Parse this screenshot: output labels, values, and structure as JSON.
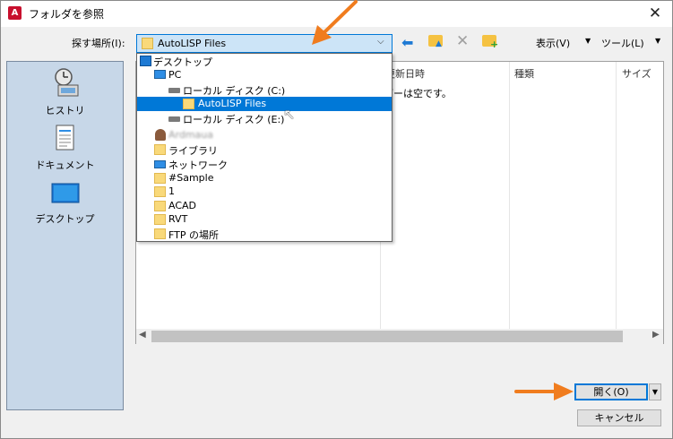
{
  "window": {
    "title": "フォルダを参照",
    "app_icon_letter": "A",
    "close_glyph": "✕"
  },
  "toolbar": {
    "lookin_label": "探す場所(I):",
    "lookin_value": "AutoLISP Files",
    "view_label": "表示(V)",
    "tools_label": "ツール(L)"
  },
  "places": [
    {
      "label": "ヒストリ",
      "icon": "history-icon"
    },
    {
      "label": "ドキュメント",
      "icon": "documents-icon"
    },
    {
      "label": "デスクトップ",
      "icon": "desktop-icon"
    }
  ],
  "filelist": {
    "columns": [
      "更新日時",
      "種類",
      "サイズ"
    ],
    "empty_message": "ダーは空です。"
  },
  "dropdown": {
    "items": [
      {
        "label": "デスクトップ",
        "icon": "desktop-icon",
        "indent": 0,
        "selected": false
      },
      {
        "label": "PC",
        "icon": "pc-icon",
        "indent": 1,
        "selected": false
      },
      {
        "label": "ローカル ディスク (C:)",
        "icon": "drive-icon",
        "indent": 2,
        "selected": false
      },
      {
        "label": "AutoLISP Files",
        "icon": "folder-icon",
        "indent": 3,
        "selected": true
      },
      {
        "label": "ローカル ディスク (E:)",
        "icon": "drive-icon",
        "indent": 2,
        "selected": false
      },
      {
        "label": "Ardmaua",
        "icon": "user-icon",
        "indent": 1,
        "selected": false
      },
      {
        "label": "ライブラリ",
        "icon": "library-icon",
        "indent": 1,
        "selected": false
      },
      {
        "label": "ネットワーク",
        "icon": "network-icon",
        "indent": 1,
        "selected": false
      },
      {
        "label": "#Sample",
        "icon": "folder-icon",
        "indent": 1,
        "selected": false
      },
      {
        "label": "1",
        "icon": "folder-icon",
        "indent": 1,
        "selected": false
      },
      {
        "label": "ACAD",
        "icon": "folder-icon",
        "indent": 1,
        "selected": false
      },
      {
        "label": "RVT",
        "icon": "folder-icon",
        "indent": 1,
        "selected": false
      },
      {
        "label": "FTP の場所",
        "icon": "ftp-folder-icon",
        "indent": 1,
        "selected": false
      }
    ]
  },
  "buttons": {
    "open_label": "開く(O)",
    "cancel_label": "キャンセル"
  },
  "colors": {
    "accent": "#0078d7",
    "annotation_arrow": "#f07c1e",
    "places_bg": "#c7d7e8"
  }
}
